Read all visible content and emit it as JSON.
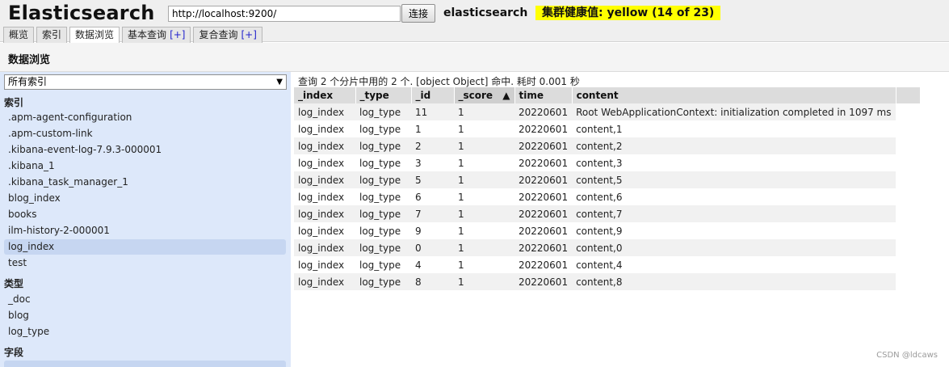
{
  "header": {
    "app_title": "Elasticsearch",
    "url_value": "http://localhost:9200/",
    "connect_label": "连接",
    "cluster_name": "elasticsearch",
    "health_text": "集群健康值: yellow (14 of 23)",
    "health_color": "#ffff00"
  },
  "tabs": [
    {
      "label": "概览"
    },
    {
      "label": "索引"
    },
    {
      "label": "数据浏览",
      "active": true
    },
    {
      "label": "基本查询",
      "plus": "[+]"
    },
    {
      "label": "复合查询",
      "plus": "[+]"
    }
  ],
  "page_title": "数据浏览",
  "sidebar": {
    "select_value": "所有索引",
    "indices_header": "索引",
    "indices": [
      ".apm-agent-configuration",
      ".apm-custom-link",
      ".kibana-event-log-7.9.3-000001",
      ".kibana_1",
      ".kibana_task_manager_1",
      "blog_index",
      "books",
      "ilm-history-2-000001",
      "log_index",
      "test"
    ],
    "selected_index": "log_index",
    "types_header": "类型",
    "types": [
      "_doc",
      "blog",
      "log_type"
    ],
    "fields_header": "字段"
  },
  "results": {
    "summary": "查询 2 个分片中用的 2 个. [object Object] 命中. 耗时 0.001 秒",
    "columns": [
      "_index",
      "_type",
      "_id",
      "_score",
      "time",
      "content"
    ],
    "sorted_column": "_score",
    "sort_arrow": "▲",
    "rows": [
      [
        "log_index",
        "log_type",
        "11",
        "1",
        "20220601",
        "Root WebApplicationContext: initialization completed in 1097 ms"
      ],
      [
        "log_index",
        "log_type",
        "1",
        "1",
        "20220601",
        "content,1"
      ],
      [
        "log_index",
        "log_type",
        "2",
        "1",
        "20220601",
        "content,2"
      ],
      [
        "log_index",
        "log_type",
        "3",
        "1",
        "20220601",
        "content,3"
      ],
      [
        "log_index",
        "log_type",
        "5",
        "1",
        "20220601",
        "content,5"
      ],
      [
        "log_index",
        "log_type",
        "6",
        "1",
        "20220601",
        "content,6"
      ],
      [
        "log_index",
        "log_type",
        "7",
        "1",
        "20220601",
        "content,7"
      ],
      [
        "log_index",
        "log_type",
        "9",
        "1",
        "20220601",
        "content,9"
      ],
      [
        "log_index",
        "log_type",
        "0",
        "1",
        "20220601",
        "content,0"
      ],
      [
        "log_index",
        "log_type",
        "4",
        "1",
        "20220601",
        "content,4"
      ],
      [
        "log_index",
        "log_type",
        "8",
        "1",
        "20220601",
        "content,8"
      ]
    ]
  },
  "watermark": "CSDN @ldcaws"
}
